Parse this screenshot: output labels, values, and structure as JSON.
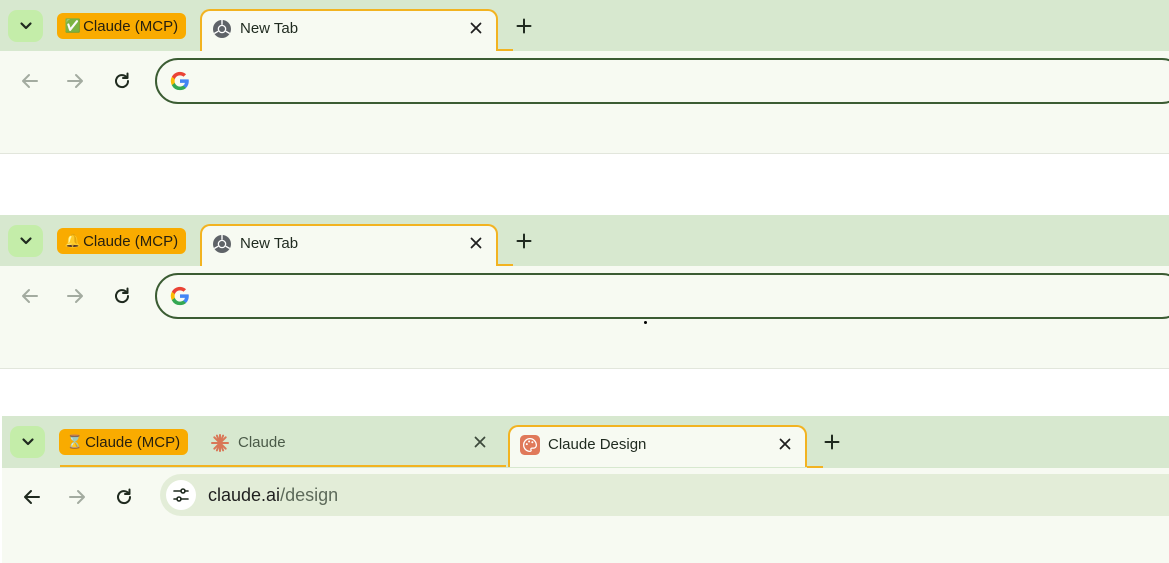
{
  "colors": {
    "tabstrip_bg": "#d7e8cf",
    "toolbar_bg": "#f7faf2",
    "group_chip": "#f9ab00",
    "tab_outline": "#f2b321",
    "omnibox_focus_border": "#3b5c33",
    "tab_search_bg": "#c4eda9"
  },
  "icons": {
    "tab_search": "chevron-down-icon",
    "back": "arrow-left-icon",
    "forward": "arrow-right-icon",
    "reload": "reload-icon",
    "new_tab": "plus-icon",
    "close": "close-icon",
    "omnibox": "google-g-icon",
    "site_info": "tune-icon"
  },
  "windows": [
    {
      "group_chip": {
        "emoji": "✅",
        "label": "Claude (MCP)"
      },
      "tabs": [
        {
          "title": "New Tab",
          "favicon": "chrome-icon",
          "active": true
        }
      ],
      "omnibox": {
        "value": ""
      }
    },
    {
      "group_chip": {
        "emoji": "🔔",
        "label": "Claude (MCP)"
      },
      "tabs": [
        {
          "title": "New Tab",
          "favicon": "chrome-icon",
          "active": true
        }
      ],
      "omnibox": {
        "value": ""
      }
    },
    {
      "group_chip": {
        "emoji": "⌛",
        "label": "Claude (MCP)"
      },
      "tabs": [
        {
          "title": "Claude",
          "favicon": "claude-burst-icon",
          "active": false
        },
        {
          "title": "Claude Design",
          "favicon": "palette-icon",
          "active": true
        }
      ],
      "omnibox": {
        "host": "claude.ai",
        "path": "/design"
      }
    }
  ]
}
